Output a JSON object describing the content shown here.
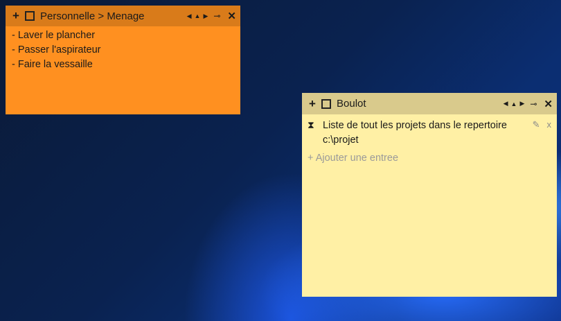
{
  "notes": [
    {
      "title": "Personnelle > Menage",
      "color": "#ff9020",
      "header_color": "#d97b1a",
      "items": [
        "- Laver le plancher",
        "- Passer l'aspirateur",
        "- Faire la vessaille"
      ]
    },
    {
      "title": "Boulot",
      "color": "#fff0a5",
      "header_color": "#d9ca8c",
      "entry_text": "Liste de tout les projets dans le repertoire c:\\projet",
      "add_entry_label": "+ Ajouter une entree"
    }
  ],
  "icons": {
    "plus": "+",
    "nav_left": "◀",
    "nav_up": "▲",
    "nav_right": "▶",
    "pin": "⊸",
    "close": "✕",
    "hourglass": "⧗",
    "edit": "✎",
    "delete": "x"
  }
}
